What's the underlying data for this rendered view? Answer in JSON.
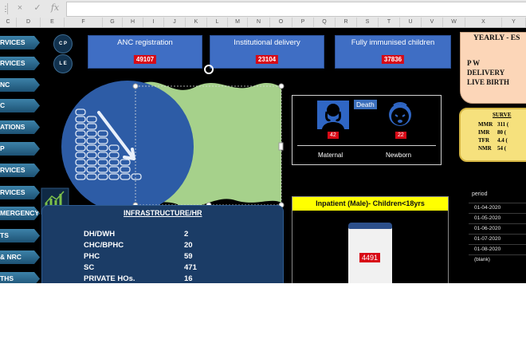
{
  "formula_bar": {
    "cancel_icon": "×",
    "enter_icon": "✓",
    "fx_label": "fx",
    "formula_value": ""
  },
  "columns": [
    "C",
    "D",
    "E",
    "F",
    "G",
    "H",
    "I",
    "J",
    "K",
    "L",
    "M",
    "N",
    "O",
    "P",
    "Q",
    "R",
    "S",
    "T",
    "U",
    "V",
    "W",
    "X",
    "Y"
  ],
  "nav": [
    {
      "label": "RVICES"
    },
    {
      "label": "RVICES"
    },
    {
      "label": "NC"
    },
    {
      "label": "C"
    },
    {
      "label": "ATIONS"
    },
    {
      "label": "P"
    },
    {
      "label": "RVICES"
    },
    {
      "label": "RVICES"
    },
    {
      "label": "MERGENCY"
    },
    {
      "label": "TS"
    },
    {
      "label": "& NRC"
    },
    {
      "label": "THS"
    }
  ],
  "circles": [
    {
      "label": "C P"
    },
    {
      "label": "L E"
    }
  ],
  "kpis": [
    {
      "title": "ANC registration",
      "value": "49107"
    },
    {
      "title": "Institutional delivery",
      "value": "23104"
    },
    {
      "title": "Fully immunised children",
      "value": "37836"
    }
  ],
  "yearly": {
    "title": "YEARLY - ES",
    "lines": [
      "P W",
      "DELIVERY",
      "LIVE BIRTH"
    ]
  },
  "survey": {
    "title": "SURVE",
    "rows": [
      {
        "label": "MMR",
        "value": "311 ("
      },
      {
        "label": "IMR",
        "value": "80 ("
      },
      {
        "label": "TFR",
        "value": "4.4 ("
      },
      {
        "label": "NMR",
        "value": "54 ("
      }
    ]
  },
  "death": {
    "title": "Death",
    "maternal": {
      "label": "Maternal",
      "value": "42"
    },
    "newborn": {
      "label": "Newborn",
      "value": "22"
    }
  },
  "infra": {
    "title": "INFRASTRUCTURE/HR",
    "rows": [
      {
        "label": "DH/DWH",
        "value": "2"
      },
      {
        "label": "CHC/BPHC",
        "value": "20"
      },
      {
        "label": "PHC",
        "value": "59"
      },
      {
        "label": "SC",
        "value": "471"
      },
      {
        "label": "PRIVATE HOs.",
        "value": "16"
      }
    ]
  },
  "inpatient": {
    "title": "Inpatient (Male)- Children<18yrs",
    "value": "4491"
  },
  "pivot": {
    "header": "period",
    "rows": [
      "01-04-2020",
      "01-05-2020",
      "01-06-2020",
      "01-07-2020",
      "01-08-2020",
      "(blank)"
    ]
  },
  "colors": {
    "kpi_blue": "#3f6ec4",
    "value_red": "#d80a16",
    "nav_blue": "#2a6a93",
    "inpatient_yellow": "#ffff00"
  }
}
